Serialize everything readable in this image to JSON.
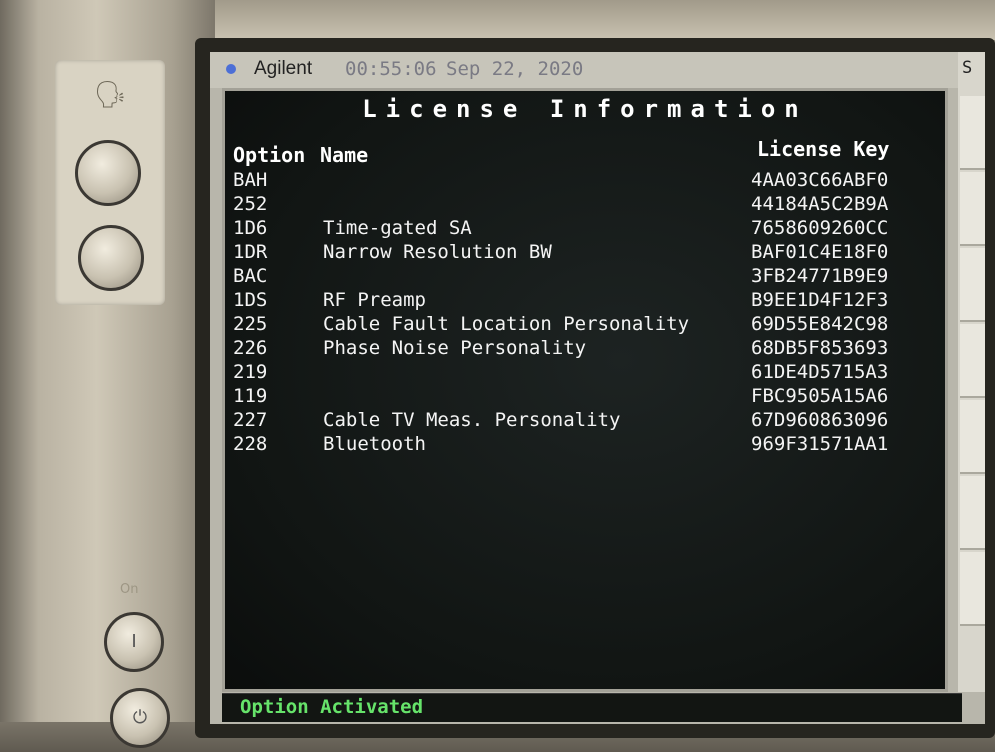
{
  "status_bar": {
    "brand": "Agilent",
    "time": "00:55:06",
    "date": "Sep 22, 2020"
  },
  "screen_title": "License Information",
  "columns": {
    "option": "Option",
    "name": "Name",
    "license_key": "License Key"
  },
  "licenses": [
    {
      "option": "BAH",
      "name": "",
      "key": "4AA03C66ABF0"
    },
    {
      "option": "252",
      "name": "",
      "key": "44184A5C2B9A"
    },
    {
      "option": "1D6",
      "name": "Time-gated SA",
      "key": "7658609260CC"
    },
    {
      "option": "1DR",
      "name": "Narrow Resolution BW",
      "key": "BAF01C4E18F0"
    },
    {
      "option": "BAC",
      "name": "",
      "key": "3FB24771B9E9"
    },
    {
      "option": "1DS",
      "name": "RF Preamp",
      "key": "B9EE1D4F12F3"
    },
    {
      "option": "225",
      "name": "Cable Fault Location Personality",
      "key": "69D55E842C98"
    },
    {
      "option": "226",
      "name": "Phase Noise Personality",
      "key": "68DB5F853693"
    },
    {
      "option": "219",
      "name": "",
      "key": "61DE4D5715A3"
    },
    {
      "option": "119",
      "name": "",
      "key": "FBC9505A15A6"
    },
    {
      "option": "227",
      "name": "Cable TV Meas. Personality",
      "key": "67D960863096"
    },
    {
      "option": "228",
      "name": "Bluetooth",
      "key": "969F31571AA1"
    }
  ],
  "message": "Option Activated",
  "softkey_label": "S",
  "front_panel": {
    "on_label": "On",
    "on_button_glyph": "I",
    "power_glyph": "⏻",
    "speaker_glyph": "🗣"
  },
  "colors": {
    "message_text": "#66e36a",
    "lcd_background": "#111513",
    "brand_dot": "#4c6fd6"
  }
}
